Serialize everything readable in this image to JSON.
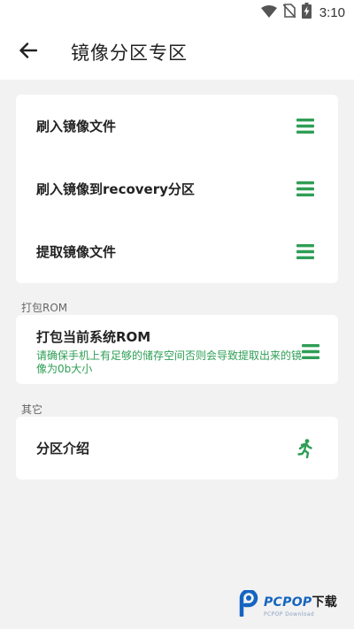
{
  "status_bar": {
    "time": "3:10",
    "icons": [
      "wifi-icon",
      "no-sim-icon",
      "battery-charging-icon"
    ]
  },
  "app_bar": {
    "back_icon": "arrow-left-icon",
    "title": "镜像分区专区"
  },
  "image_actions": {
    "items": [
      {
        "label": "刷入镜像文件",
        "icon": "menu-lines-icon"
      },
      {
        "label": "刷入镜像到recovery分区",
        "icon": "menu-lines-icon"
      },
      {
        "label": "提取镜像文件",
        "icon": "menu-lines-icon"
      }
    ]
  },
  "pack_section": {
    "header": "打包ROM",
    "item": {
      "label": "打包当前系统ROM",
      "description": "请确保手机上有足够的储存空间否则会导致提取出来的镜像为0b大小",
      "icon": "menu-lines-icon"
    }
  },
  "other_section": {
    "header": "其它",
    "item": {
      "label": "分区介绍",
      "icon": "running-person-icon"
    }
  },
  "watermark": {
    "brand": "PCPOP",
    "suffix": "下载",
    "sub": "PCPOP Download"
  },
  "colors": {
    "accent_green": "#2e9e55",
    "background": "#f2f2f2",
    "card": "#ffffff",
    "watermark_blue": "#1565c0"
  }
}
